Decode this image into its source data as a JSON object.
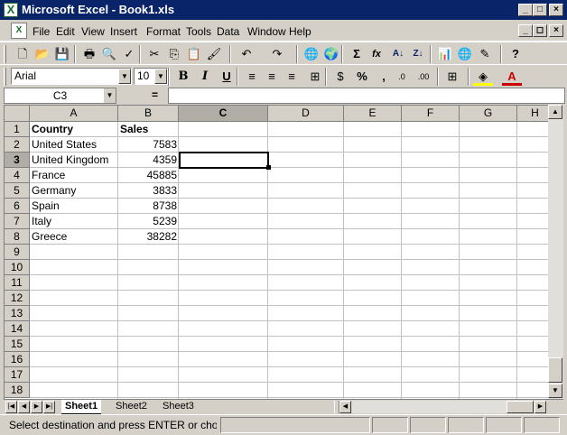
{
  "window": {
    "title": "Microsoft Excel - Book1.xls",
    "app_icon_glyph": "X",
    "controls": [
      "_",
      "□",
      "×"
    ],
    "doc_controls": [
      "_",
      "◻",
      "×"
    ]
  },
  "menu": [
    "File",
    "Edit",
    "View",
    "Insert",
    "Format",
    "Tools",
    "Data",
    "Window",
    "Help"
  ],
  "standard_toolbar": [
    {
      "name": "new-icon",
      "glyph": "🗋"
    },
    {
      "name": "open-icon",
      "glyph": "📂"
    },
    {
      "name": "save-icon",
      "glyph": "💾"
    },
    {
      "name": "print-icon",
      "glyph": "🖶"
    },
    {
      "name": "print-preview-icon",
      "glyph": "🔍"
    },
    {
      "name": "spelling-icon",
      "glyph": "✓"
    },
    {
      "name": "cut-icon",
      "glyph": "✂"
    },
    {
      "name": "copy-icon",
      "glyph": "⎘"
    },
    {
      "name": "paste-icon",
      "glyph": "📋"
    },
    {
      "name": "format-painter-icon",
      "glyph": "🖌"
    },
    {
      "name": "undo-icon",
      "glyph": "↶"
    },
    {
      "name": "redo-icon",
      "glyph": "↷"
    },
    {
      "name": "hyperlink-icon",
      "glyph": "🌐"
    },
    {
      "name": "web-toolbar-icon",
      "glyph": "🌍"
    },
    {
      "name": "autosum-icon",
      "glyph": "Σ"
    },
    {
      "name": "function-icon",
      "glyph": "fx"
    },
    {
      "name": "sort-ascending-icon",
      "glyph": "A↓"
    },
    {
      "name": "sort-descending-icon",
      "glyph": "Z↓"
    },
    {
      "name": "chart-wizard-icon",
      "glyph": "📊"
    },
    {
      "name": "map-icon",
      "glyph": "🌐"
    },
    {
      "name": "drawing-icon",
      "glyph": "✎"
    },
    {
      "name": "help-icon",
      "glyph": "?"
    }
  ],
  "format_toolbar": {
    "font": "Arial",
    "size": "10",
    "buttons": [
      {
        "name": "bold-icon",
        "glyph": "B"
      },
      {
        "name": "italic-icon",
        "glyph": "I"
      },
      {
        "name": "underline-icon",
        "glyph": "U"
      },
      {
        "name": "align-left-icon",
        "glyph": "≡"
      },
      {
        "name": "align-center-icon",
        "glyph": "≡"
      },
      {
        "name": "align-right-icon",
        "glyph": "≡"
      },
      {
        "name": "merge-center-icon",
        "glyph": "⊞"
      },
      {
        "name": "currency-icon",
        "glyph": "$"
      },
      {
        "name": "percent-icon",
        "glyph": "%"
      },
      {
        "name": "comma-icon",
        "glyph": ","
      },
      {
        "name": "increase-decimal-icon",
        "glyph": ".0"
      },
      {
        "name": "decrease-decimal-icon",
        "glyph": ".00"
      },
      {
        "name": "borders-icon",
        "glyph": "⊞"
      },
      {
        "name": "fill-color-icon",
        "glyph": "◈"
      },
      {
        "name": "font-color-icon",
        "glyph": "A"
      }
    ]
  },
  "formula_bar": {
    "name_box": "C3",
    "equals": "=",
    "content": ""
  },
  "columns": [
    "A",
    "B",
    "C",
    "D",
    "E",
    "F",
    "G",
    "H"
  ],
  "selected_column": "C",
  "rows": [
    "1",
    "2",
    "3",
    "4",
    "5",
    "6",
    "7",
    "8",
    "9",
    "10",
    "11",
    "12",
    "13",
    "14",
    "15",
    "16",
    "17",
    "18"
  ],
  "selected_row": "3",
  "table": {
    "header": [
      "Country",
      "Sales"
    ],
    "data": [
      [
        "United States",
        "7583"
      ],
      [
        "United Kingdom",
        "4359"
      ],
      [
        "France",
        "45885"
      ],
      [
        "Germany",
        "3833"
      ],
      [
        "Spain",
        "8738"
      ],
      [
        "Italy",
        "5239"
      ],
      [
        "Greece",
        "38282"
      ]
    ]
  },
  "sheets": [
    "Sheet1",
    "Sheet2",
    "Sheet3"
  ],
  "active_sheet": "Sheet1",
  "status": "Select destination and press ENTER or choose Paste"
}
